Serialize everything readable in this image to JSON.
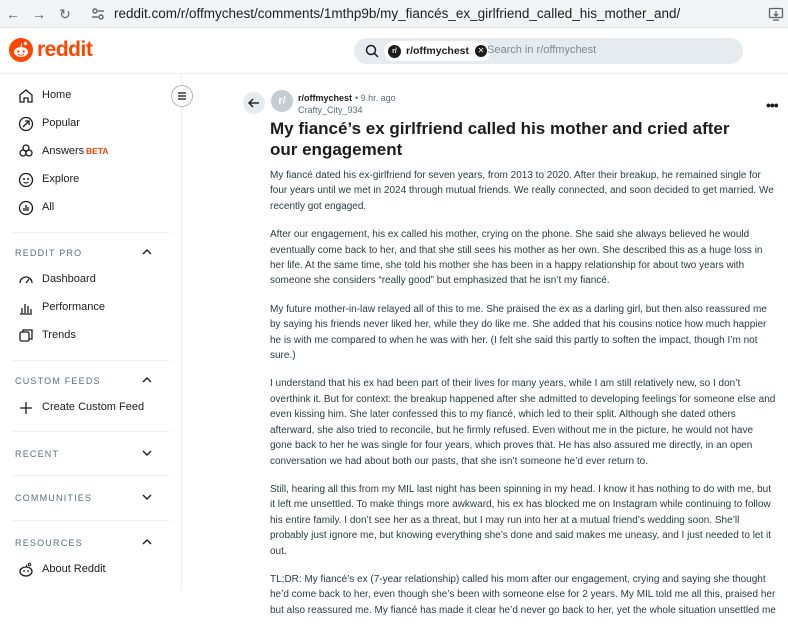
{
  "browser": {
    "url": "reddit.com/r/offmychest/comments/1mthp9b/my_fiancés_ex_girlfriend_called_his_mother_and/"
  },
  "header": {
    "logo_text": "reddit",
    "search_chip": "r/offmychest",
    "search_placeholder": "Search in r/offmychest"
  },
  "sidebar": {
    "main": [
      {
        "label": "Home",
        "icon": "home-icon"
      },
      {
        "label": "Popular",
        "icon": "popular-icon"
      },
      {
        "label": "Answers",
        "icon": "answers-icon",
        "badge": "BETA"
      },
      {
        "label": "Explore",
        "icon": "explore-icon"
      },
      {
        "label": "All",
        "icon": "all-icon"
      }
    ],
    "reddit_pro": {
      "title": "REDDIT PRO",
      "items": [
        {
          "label": "Dashboard",
          "icon": "dashboard-icon"
        },
        {
          "label": "Performance",
          "icon": "performance-icon"
        },
        {
          "label": "Trends",
          "icon": "trends-icon"
        }
      ]
    },
    "custom_feeds": {
      "title": "CUSTOM FEEDS",
      "items": [
        {
          "label": "Create Custom Feed",
          "icon": "plus-icon"
        }
      ]
    },
    "recent": {
      "title": "RECENT"
    },
    "communities": {
      "title": "COMMUNITIES"
    },
    "resources": {
      "title": "RESOURCES",
      "items": [
        {
          "label": "About Reddit",
          "icon": "reddit-icon"
        }
      ]
    }
  },
  "post": {
    "subreddit": "r/offmychest",
    "time": "• 9 hr. ago",
    "author": "Crafty_City_934",
    "title": "My fiancé’s ex girlfriend called his mother and cried after our engagement",
    "paragraphs": [
      "My fiancé dated his ex-girlfriend for seven years, from 2013 to 2020. After their breakup, he remained single for four years until we met in 2024 through mutual friends. We really connected, and soon decided to get married. We recently got engaged.",
      "After our engagement, his ex called his mother, crying on the phone. She said she always believed he would eventually come back to her, and that she still sees his mother as her own. She described this as a huge loss in her life. At the same time, she told his mother she has been in a happy relationship for about two years with someone she considers “really good” but emphasized that he isn’t my fiancé.",
      "My future mother-in-law relayed all of this to me. She praised the ex as a darling girl, but then also reassured me by saying his friends never liked her, while they do like me. She added that his cousins notice how much happier he is with me compared to when he was with her. (I felt she said this partly to soften the impact, though I’m not sure.)",
      "I understand that his ex had been part of their lives for many years, while I am still relatively new, so I don’t overthink it. But for context: the breakup happened after she admitted to developing feelings for someone else and even kissing him. She later confessed this to my fiancé, which led to their split. Although she dated others afterward, she also tried to reconcile, but he firmly refused. Even without me in the picture, he would not have gone back to her he was single for four years, which proves that. He has also assured me directly, in an open conversation we had about both our pasts, that she isn’t someone he’d ever return to.",
      "Still, hearing all this from my MIL last night has been spinning in my head. I know it has nothing to do with me, but it left me unsettled. To make things more awkward, his ex has blocked me on Instagram while continuing to follow his entire family. I don’t see her as a threat, but I may run into her at a mutual friend’s wedding soon. She’ll probably just ignore me, but knowing everything she’s done and said makes me uneasy, and I just needed to let it out.",
      "TL;DR: My fiancé’s ex (7-year relationship) called his mom after our engagement, crying and saying she thought he’d come back to her, even though she’s been with someone else for 2 years. My MIL told me all this, praised her but also reassured me. My fiancé has made it clear he’d never go back to her, yet the whole situation unsettled me"
    ]
  },
  "colors": {
    "brand": "#ff4500",
    "text": "#1c1c1c",
    "muted": "#576f76"
  }
}
